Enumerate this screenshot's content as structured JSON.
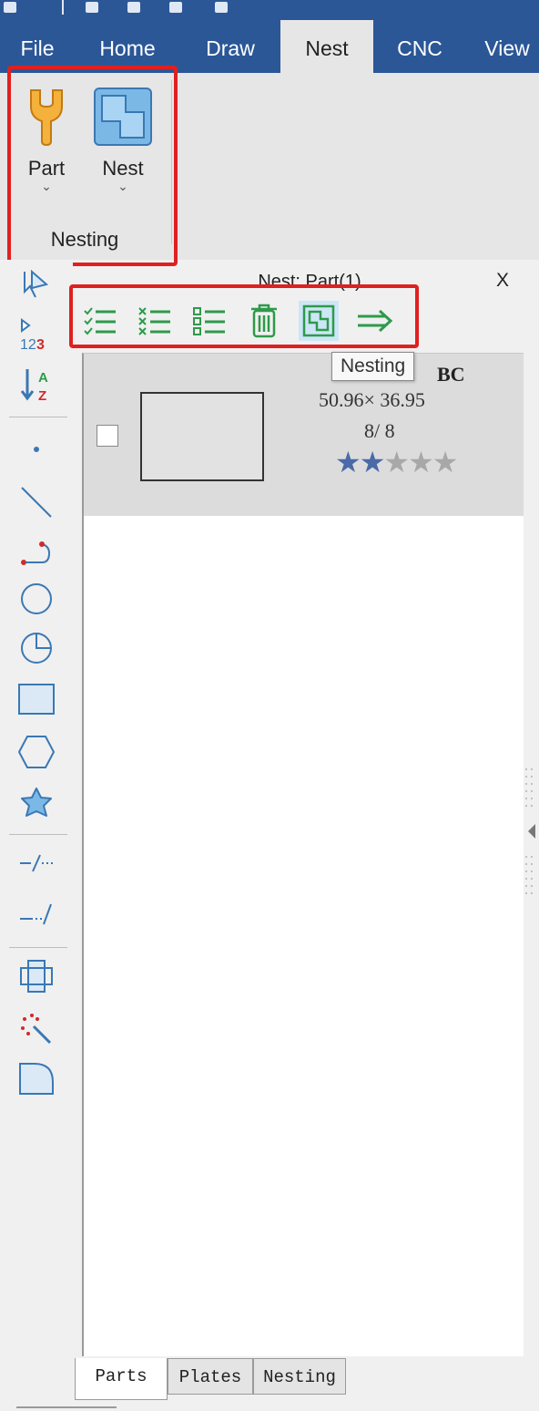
{
  "menu": {
    "tabs": [
      {
        "label": "File"
      },
      {
        "label": "Home"
      },
      {
        "label": "Draw"
      },
      {
        "label": "Nest"
      },
      {
        "label": "CNC"
      },
      {
        "label": "View"
      }
    ],
    "active_tab": "Nest"
  },
  "ribbon": {
    "buttons": [
      {
        "label": "Part",
        "icon": "part-wrench-icon"
      },
      {
        "label": "Nest",
        "icon": "nest-layout-icon"
      }
    ],
    "group_label": "Nesting"
  },
  "left_toolbar": {
    "tools": [
      "select-arrow-icon",
      "sort-number-icon",
      "sort-az-icon",
      "point-icon",
      "line-icon",
      "polyline-arc-icon",
      "circle-icon",
      "arc-sector-icon",
      "rectangle-icon",
      "hexagon-icon",
      "star-shape-icon",
      "break-line-icon",
      "extend-line-icon",
      "array-icon",
      "magic-wand-icon",
      "rounded-corner-icon"
    ]
  },
  "panel": {
    "title": "Nest: Part(1)",
    "close_label": "X",
    "toolbar": [
      "check-all-icon",
      "uncheck-all-icon",
      "list-icon",
      "trash-icon",
      "nesting-icon",
      "arrow-right-icon"
    ],
    "tooltip": "Nesting",
    "part": {
      "name_visible": "BC",
      "dims": "50.96× 36.95",
      "count": "8/ 8",
      "rating": 2,
      "rating_max": 5
    }
  },
  "bottom_tabs": [
    {
      "label": "Parts"
    },
    {
      "label": "Plates"
    },
    {
      "label": "Nesting"
    }
  ],
  "colors": {
    "title_bar": "#2b5797",
    "highlight_border": "#e02020",
    "star_filled": "#4a6aa8",
    "star_empty": "#a8a8a8",
    "icon_green": "#2e9a4a"
  }
}
